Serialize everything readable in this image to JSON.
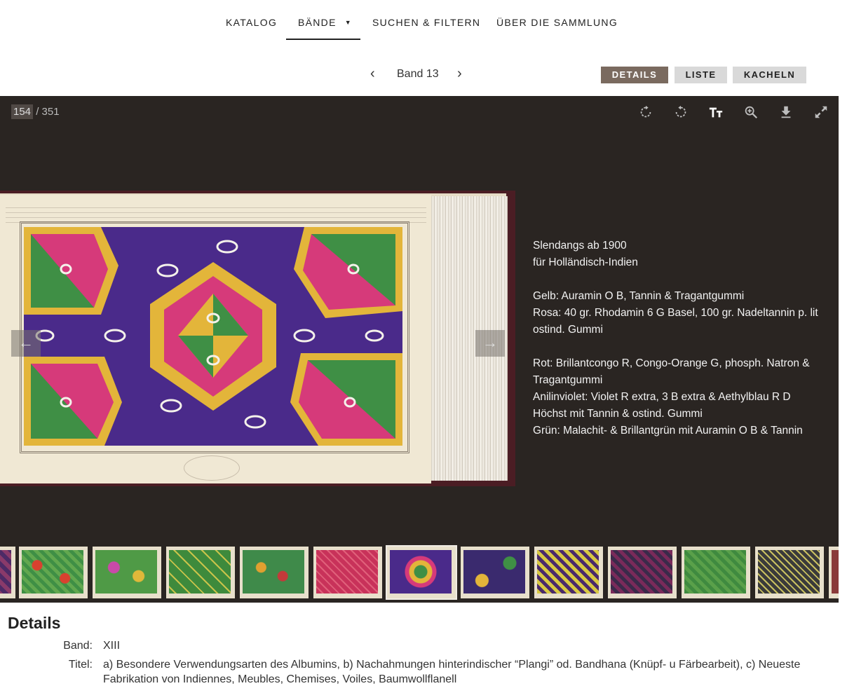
{
  "nav": {
    "items": [
      "KATALOG",
      "BÄNDE",
      "SUCHEN & FILTERN",
      "ÜBER DIE SAMMLUNG"
    ],
    "active": "BÄNDE"
  },
  "band": {
    "label": "Band 13",
    "prev_icon": "chevron-left-icon",
    "next_icon": "chevron-right-icon"
  },
  "views": {
    "details": "DETAILS",
    "liste": "LISTE",
    "kacheln": "KACHELN",
    "active": "DETAILS"
  },
  "viewer": {
    "page_current": "154",
    "page_total": "/ 351",
    "tools": [
      "rotate-right-icon",
      "rotate-left-icon",
      "text-size-icon",
      "zoom-in-icon",
      "download-icon",
      "fullscreen-icon"
    ],
    "description": [
      "Slendangs ab 1900",
      "für Holländisch-Indien",
      "",
      "Gelb: Auramin O B, Tannin & Tragantgummi",
      "Rosa: 40 gr. Rhodamin 6 G Basel, 100 gr. Nadeltannin p. lit ostind. Gummi",
      "",
      "Rot: Brillantcongo R, Congo-Orange G, phosph. Natron & Tragantgummi",
      "Anilinviolet: Violet R extra, 3 B extra & Aethylblau R D Höchst mit Tannin & ostind. Gummi",
      "Grün: Malachit- & Brillantgrün mit Auramin O B & Tannin"
    ]
  },
  "colors": {
    "viewer_bg": "#2a2522",
    "accent_button": "#7a6a5f",
    "inactive_button": "#d9d9d9",
    "textile_purple": "#4a2a8a",
    "textile_yellow": "#e3b53a",
    "textile_pink": "#d63a7a",
    "textile_green": "#3f8f45"
  },
  "details": {
    "title": "Details",
    "band_label": "Band:",
    "band_value": "XIII",
    "titel_label": "Titel:",
    "titel_value": "a) Besondere Verwendungsarten des Albumins, b) Nachahmungen hinterindischer “Plangi” od. Bandhana (Knüpf- u Färbearbeit), c) Neueste Fabrikation von Indiennes, Meubles, Chemises, Voiles, Baumwollflanell"
  }
}
